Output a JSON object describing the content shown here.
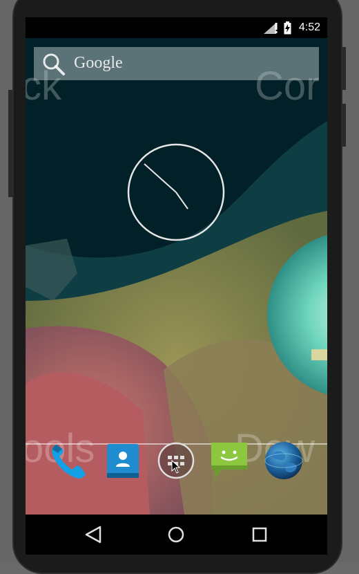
{
  "status_bar": {
    "time": "4:52",
    "icons": [
      "signal-icon",
      "no-sim-icon",
      "battery-icon"
    ]
  },
  "search_widget": {
    "label": "Google",
    "icon": "search-icon"
  },
  "clock_widget": {
    "type": "analog-clock"
  },
  "wallpaper_labels": {
    "top_left": "ck",
    "top_right": "Cor",
    "bottom_left": "ools",
    "bottom_right": "Dow"
  },
  "dock": {
    "items": [
      {
        "name": "phone",
        "icon": "phone-icon"
      },
      {
        "name": "contacts",
        "icon": "contacts-icon"
      },
      {
        "name": "all-apps",
        "icon": "app-drawer-icon"
      },
      {
        "name": "messaging",
        "icon": "messaging-icon"
      },
      {
        "name": "browser",
        "icon": "globe-icon"
      }
    ]
  },
  "nav_bar": {
    "buttons": [
      "back-icon",
      "home-icon",
      "recents-icon"
    ]
  },
  "colors": {
    "status_bar": "#000000",
    "wallpaper_dark": "#022027",
    "clock_ring": "#e6e6e6",
    "messaging_green": "#8dc63f",
    "contacts_blue": "#1e8ccf",
    "phone_blue": "#14a0e6"
  }
}
